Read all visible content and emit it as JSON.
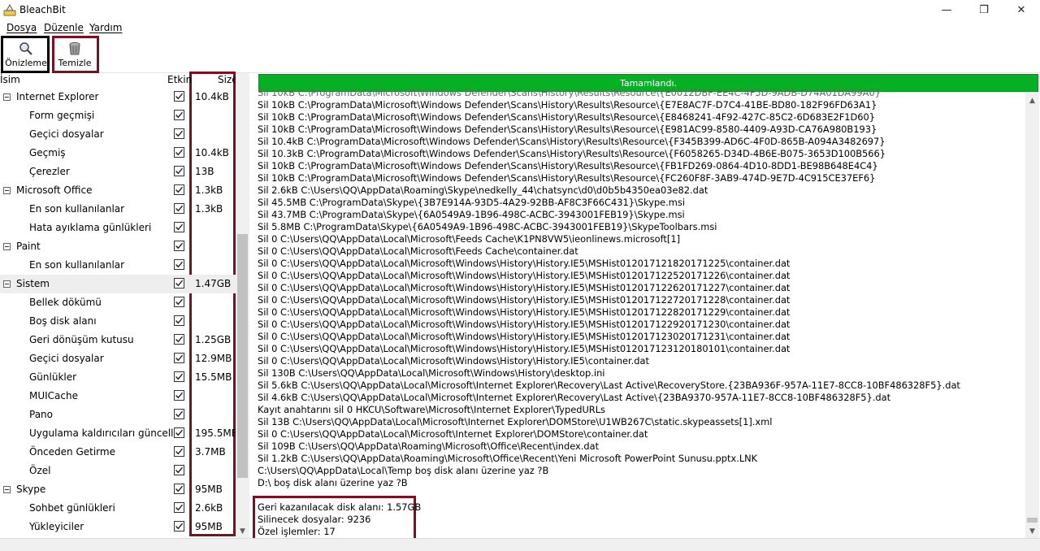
{
  "window": {
    "title": "BleachBit"
  },
  "menu": [
    {
      "label": "Dosya"
    },
    {
      "label": "Düzenle"
    },
    {
      "label": "Yardım"
    }
  ],
  "toolbar": {
    "preview_label": "Önizleme",
    "clean_label": "Temizle"
  },
  "columns": {
    "name": "İsim",
    "enabled": "Etkin",
    "size": "Size"
  },
  "tree": [
    {
      "label": "Internet Explorer",
      "size": "10.4kB",
      "level": 0,
      "checked": true,
      "expanded": true
    },
    {
      "label": "Form geçmişi",
      "size": "",
      "level": 1,
      "checked": true
    },
    {
      "label": "Geçici dosyalar",
      "size": "",
      "level": 1,
      "checked": true
    },
    {
      "label": "Geçmiş",
      "size": "10.4kB",
      "level": 1,
      "checked": true
    },
    {
      "label": "Çerezler",
      "size": "13B",
      "level": 1,
      "checked": true
    },
    {
      "label": "Microsoft Office",
      "size": "1.3kB",
      "level": 0,
      "checked": true,
      "expanded": true
    },
    {
      "label": "En son kullanılanlar",
      "size": "1.3kB",
      "level": 1,
      "checked": true
    },
    {
      "label": "Hata ayıklama günlükleri",
      "size": "",
      "level": 1,
      "checked": true
    },
    {
      "label": "Paint",
      "size": "",
      "level": 0,
      "checked": true,
      "expanded": true
    },
    {
      "label": "En son kullanılanlar",
      "size": "",
      "level": 1,
      "checked": true
    },
    {
      "label": "Sistem",
      "size": "1.47GB",
      "level": 0,
      "checked": true,
      "expanded": true,
      "selected": true
    },
    {
      "label": "Bellek dökümü",
      "size": "",
      "level": 1,
      "checked": true
    },
    {
      "label": "Boş disk alanı",
      "size": "",
      "level": 1,
      "checked": true
    },
    {
      "label": "Geri dönüşüm kutusu",
      "size": "1.25GB",
      "level": 1,
      "checked": true
    },
    {
      "label": "Geçici dosyalar",
      "size": "12.9MB",
      "level": 1,
      "checked": true
    },
    {
      "label": "Günlükler",
      "size": "15.5MB",
      "level": 1,
      "checked": true
    },
    {
      "label": "MUICache",
      "size": "",
      "level": 1,
      "checked": true
    },
    {
      "label": "Pano",
      "size": "",
      "level": 1,
      "checked": true
    },
    {
      "label": "Uygulama kaldırıcıları güncelle",
      "size": "195.5MB",
      "level": 1,
      "checked": true
    },
    {
      "label": "Önceden Getirme",
      "size": "3.7MB",
      "level": 1,
      "checked": true
    },
    {
      "label": "Özel",
      "size": "",
      "level": 1,
      "checked": true
    },
    {
      "label": "Skype",
      "size": "95MB",
      "level": 0,
      "checked": true,
      "expanded": true
    },
    {
      "label": "Sohbet günlükleri",
      "size": "2.6kB",
      "level": 1,
      "checked": true
    },
    {
      "label": "Yükleyiciler",
      "size": "95MB",
      "level": 1,
      "checked": true
    }
  ],
  "progress": {
    "text": "Tamamlandı.",
    "fraction": 1.0
  },
  "log": [
    "Sil 10kB C:\\ProgramData\\Microsoft\\Windows Defender\\Scans\\History\\Results\\Resource\\{E7E8AC7F-D7C4-41BE-BD80-182F96FD63A1}",
    "Sil 10kB C:\\ProgramData\\Microsoft\\Windows Defender\\Scans\\History\\Results\\Resource\\{E8468241-4F92-427C-85C2-6D683E2F1D60}",
    "Sil 10kB C:\\ProgramData\\Microsoft\\Windows Defender\\Scans\\History\\Results\\Resource\\{E981AC99-8580-4409-A93D-CA76A980B193}",
    "Sil 10.4kB C:\\ProgramData\\Microsoft\\Windows Defender\\Scans\\History\\Results\\Resource\\{F345B399-AD6C-4F0D-865B-A094A3482697}",
    "Sil 10.3kB C:\\ProgramData\\Microsoft\\Windows Defender\\Scans\\History\\Results\\Resource\\{F6058265-D34D-4B6E-B075-3653D100B566}",
    "Sil 10kB C:\\ProgramData\\Microsoft\\Windows Defender\\Scans\\History\\Results\\Resource\\{FB1FD269-0864-4D10-8DD1-BE98B648E4C4}",
    "Sil 10kB C:\\ProgramData\\Microsoft\\Windows Defender\\Scans\\History\\Results\\Resource\\{FC260F8F-3AB9-474D-9E7D-4C915CE37EF6}",
    "Sil 2.6kB C:\\Users\\QQ\\AppData\\Roaming\\Skype\\nedkelly_44\\chatsync\\d0\\d0b5b4350ea03e82.dat",
    "Sil 45.5MB C:\\ProgramData\\Skype\\{3B7E914A-93D5-4A29-92BB-AF8C3F66C431}\\Skype.msi",
    "Sil 43.7MB C:\\ProgramData\\Skype\\{6A0549A9-1B96-498C-ACBC-3943001FEB19}\\Skype.msi",
    "Sil 5.8MB C:\\ProgramData\\Skype\\{6A0549A9-1B96-498C-ACBC-3943001FEB19}\\SkypeToolbars.msi",
    "Sil 0 C:\\Users\\QQ\\AppData\\Local\\Microsoft\\Feeds Cache\\K1PN8VW5\\ieonlinews.microsoft[1]",
    "Sil 0 C:\\Users\\QQ\\AppData\\Local\\Microsoft\\Feeds Cache\\container.dat",
    "Sil 0 C:\\Users\\QQ\\AppData\\Local\\Microsoft\\Windows\\History\\History.IE5\\MSHist012017121820171225\\container.dat",
    "Sil 0 C:\\Users\\QQ\\AppData\\Local\\Microsoft\\Windows\\History\\History.IE5\\MSHist012017122520171226\\container.dat",
    "Sil 0 C:\\Users\\QQ\\AppData\\Local\\Microsoft\\Windows\\History\\History.IE5\\MSHist012017122620171227\\container.dat",
    "Sil 0 C:\\Users\\QQ\\AppData\\Local\\Microsoft\\Windows\\History\\History.IE5\\MSHist012017122720171228\\container.dat",
    "Sil 0 C:\\Users\\QQ\\AppData\\Local\\Microsoft\\Windows\\History\\History.IE5\\MSHist012017122820171229\\container.dat",
    "Sil 0 C:\\Users\\QQ\\AppData\\Local\\Microsoft\\Windows\\History\\History.IE5\\MSHist012017122920171230\\container.dat",
    "Sil 0 C:\\Users\\QQ\\AppData\\Local\\Microsoft\\Windows\\History\\History.IE5\\MSHist012017123020171231\\container.dat",
    "Sil 0 C:\\Users\\QQ\\AppData\\Local\\Microsoft\\Windows\\History\\History.IE5\\MSHist012017123120180101\\container.dat",
    "Sil 0 C:\\Users\\QQ\\AppData\\Local\\Microsoft\\Windows\\History\\History.IE5\\container.dat",
    "Sil 130B C:\\Users\\QQ\\AppData\\Local\\Microsoft\\Windows\\History\\desktop.ini",
    "Sil 5.6kB C:\\Users\\QQ\\AppData\\Local\\Microsoft\\Internet Explorer\\Recovery\\Last Active\\RecoveryStore.{23BA936F-957A-11E7-8CC8-10BF486328F5}.dat",
    "Sil 4.6kB C:\\Users\\QQ\\AppData\\Local\\Microsoft\\Internet Explorer\\Recovery\\Last Active\\{23BA9370-957A-11E7-8CC8-10BF486328F5}.dat",
    "Kayıt anahtarını sil 0 HKCU\\Software\\Microsoft\\Internet Explorer\\TypedURLs",
    "Sil 13B C:\\Users\\QQ\\AppData\\Local\\Microsoft\\Internet Explorer\\DOMStore\\U1WB267C\\static.skypeassets[1].xml",
    "Sil 0 C:\\Users\\QQ\\AppData\\Local\\Microsoft\\Internet Explorer\\DOMStore\\container.dat",
    "Sil 109B C:\\Users\\QQ\\AppData\\Roaming\\Microsoft\\Office\\Recent\\index.dat",
    "Sil 1.2kB C:\\Users\\QQ\\AppData\\Roaming\\Microsoft\\Office\\Recent\\Yeni Microsoft PowerPoint Sunusu.pptx.LNK",
    "C:\\Users\\QQ\\AppData\\Local\\Temp boş disk alanı üzerine yaz ?B",
    "D:\\ boş disk alanı üzerine yaz ?B",
    "",
    "Geri kazanılacak disk alanı: 1.57GB",
    "Silinecek dosyalar: 9236",
    "Özel işlemler: 17"
  ],
  "colors": {
    "progress_fill": "#06b025",
    "highlight_box": "#7a1020"
  },
  "icons": {
    "preview": "magnifier-icon",
    "clean": "trash-can-icon",
    "app": "bleachbit-app-icon"
  }
}
